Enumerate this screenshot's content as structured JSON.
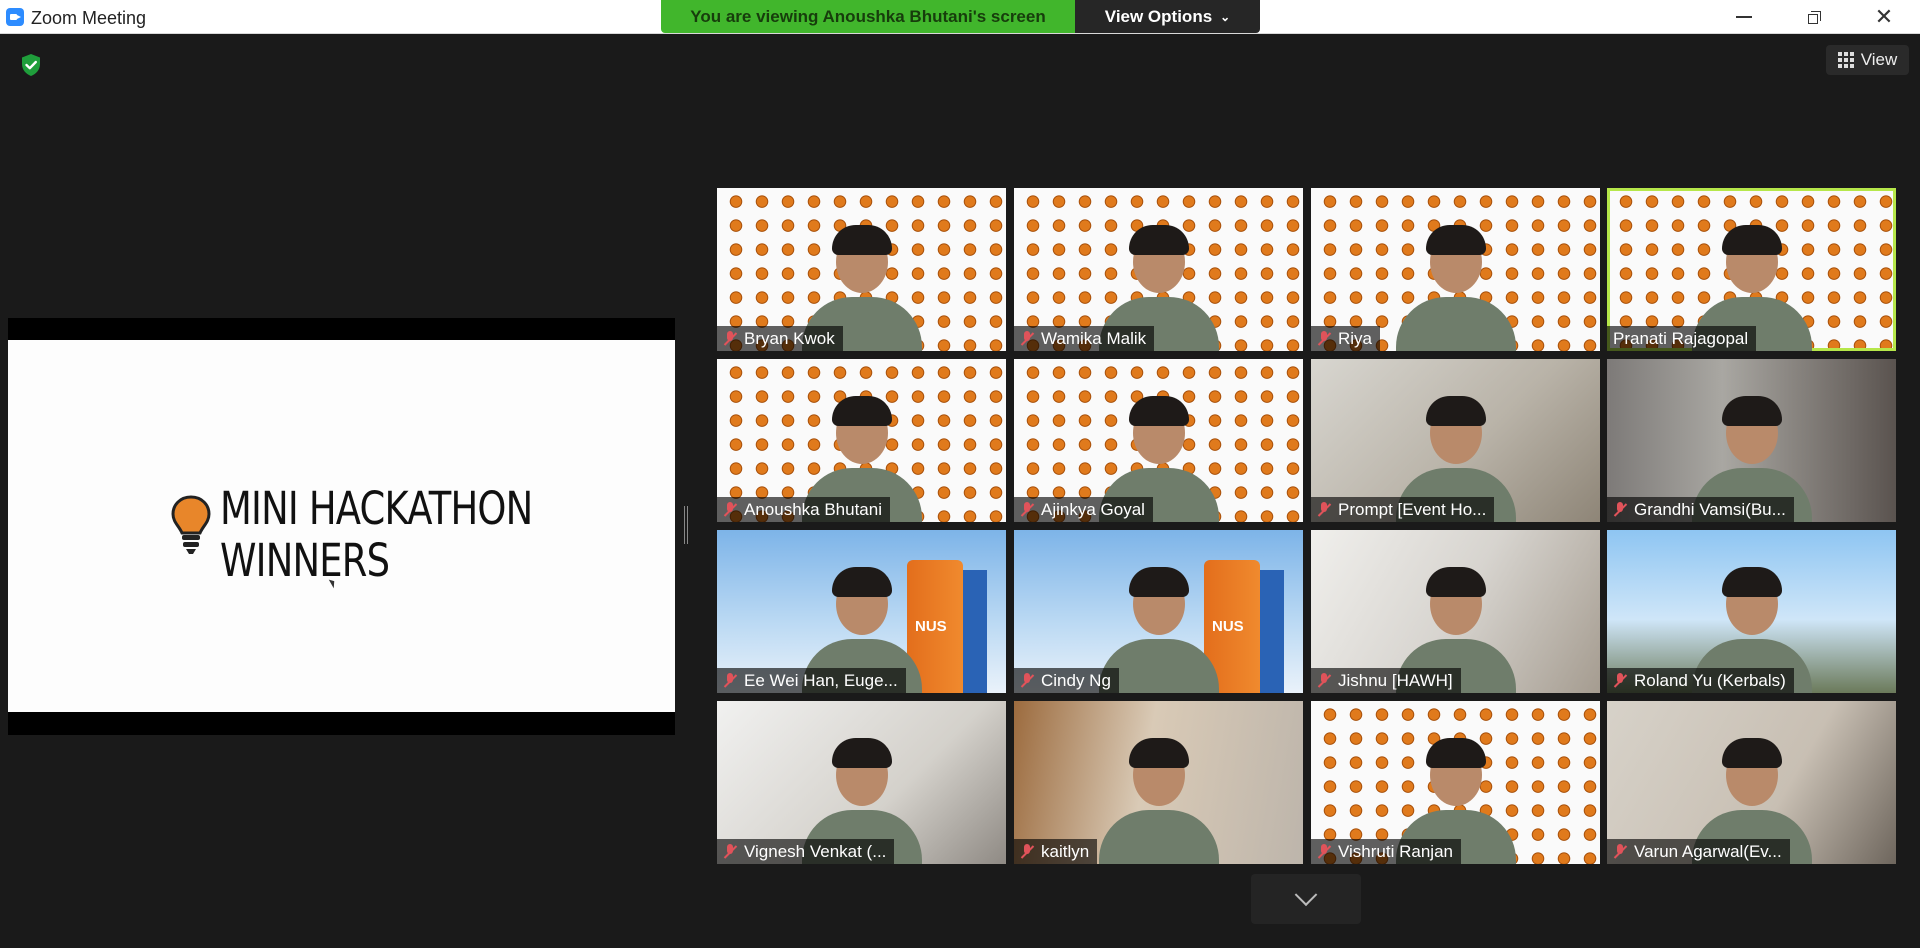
{
  "window": {
    "title": "Zoom Meeting"
  },
  "share_banner": {
    "text": "You are viewing Anoushka Bhutani's screen",
    "view_options_label": "View Options"
  },
  "toolbar": {
    "view_label": "View"
  },
  "slide": {
    "title": "MINI HACKATHON\nWINNERS"
  },
  "colors": {
    "banner_green": "#41b62c",
    "active_speaker": "#b6e74a",
    "muted_red": "#e0535a",
    "zoom_blue": "#2d8cff"
  },
  "participants": [
    {
      "name": "Bryan Kwok",
      "muted": true,
      "background": "lightbulbs"
    },
    {
      "name": "Wamika Malik",
      "muted": true,
      "background": "lightbulbs"
    },
    {
      "name": "Riya",
      "muted": true,
      "background": "lightbulbs"
    },
    {
      "name": "Pranati Rajagopal",
      "muted": false,
      "active_speaker": true,
      "background": "lightbulbs"
    },
    {
      "name": "Anoushka Bhutani",
      "muted": true,
      "background": "lightbulbs"
    },
    {
      "name": "Ajinkya Goyal",
      "muted": true,
      "background": "lightbulbs"
    },
    {
      "name": "Prompt [Event Ho...",
      "muted": true,
      "background": "room"
    },
    {
      "name": "Grandhi Vamsi(Bu...",
      "muted": true,
      "background": "room"
    },
    {
      "name": "Ee Wei Han, Euge...",
      "muted": true,
      "background": "nus"
    },
    {
      "name": "Cindy Ng",
      "muted": true,
      "background": "nus"
    },
    {
      "name": "Jishnu [HAWH]",
      "muted": true,
      "background": "room"
    },
    {
      "name": "Roland Yu (Kerbals)",
      "muted": true,
      "background": "kerbal"
    },
    {
      "name": "Vignesh Venkat (...",
      "muted": true,
      "background": "room"
    },
    {
      "name": "kaitlyn",
      "muted": true,
      "background": "room"
    },
    {
      "name": "Vishruti Ranjan",
      "muted": true,
      "background": "lightbulbs"
    },
    {
      "name": "Varun Agarwal(Ev...",
      "muted": true,
      "background": "room"
    }
  ],
  "icons": [
    "zoom-logo-icon",
    "minimize-icon",
    "restore-icon",
    "close-icon",
    "shield-check-icon",
    "grid-view-icon",
    "muted-mic-icon",
    "chevron-down-icon",
    "lightbulb-icon"
  ]
}
